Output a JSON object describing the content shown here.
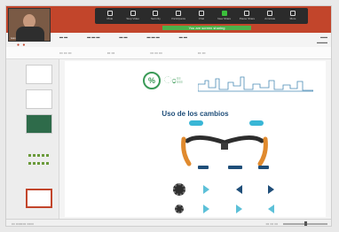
{
  "meeting": {
    "toolbar": [
      {
        "label": "Mute",
        "icon": "microphone-icon"
      },
      {
        "label": "Stop Video",
        "icon": "video-camera-icon"
      },
      {
        "label": "Security",
        "icon": "shield-icon"
      },
      {
        "label": "Participants",
        "icon": "participants-icon"
      },
      {
        "label": "Chat",
        "icon": "chat-icon"
      },
      {
        "label": "New Share",
        "icon": "share-screen-icon"
      },
      {
        "label": "Pause Share",
        "icon": "pause-icon"
      },
      {
        "label": "Annotate",
        "icon": "pen-icon"
      },
      {
        "label": "More",
        "icon": "more-icon"
      }
    ],
    "sharing_label": "You are screen sharing",
    "participant_name": "Ivan"
  },
  "slide": {
    "logo_symbol": "%",
    "title": "Uso de los cambios"
  },
  "brand_colors": {
    "ribbon": "#c2452b",
    "green": "#3a9a57",
    "navy": "#1f4e79",
    "cyan": "#39b6d6"
  }
}
